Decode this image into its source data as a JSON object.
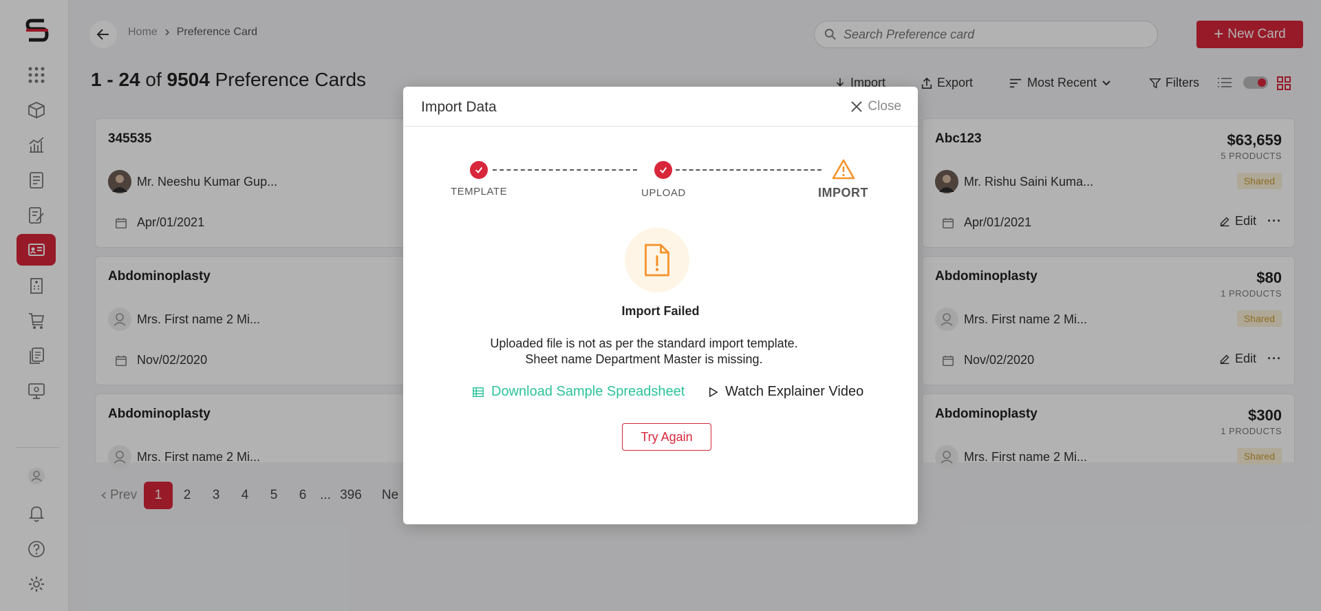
{
  "header": {
    "breadcrumb": [
      "Home",
      "Preference Card"
    ],
    "search_placeholder": "Search Preference card",
    "new_card_label": "New Card"
  },
  "title": {
    "range": "1 - 24",
    "of_word": "of",
    "total": "9504",
    "noun": "Preference Cards"
  },
  "toolbar": {
    "import_label": "Import",
    "export_label": "Export",
    "sort_label": "Most Recent",
    "filters_label": "Filters"
  },
  "cards": [
    {
      "title": "345535",
      "owner": "Mr. Neeshu Kumar Gup...",
      "date": "Apr/01/2021"
    },
    {
      "title": "Abc123",
      "price": "$63,659",
      "products": "5 PRODUCTS",
      "owner": "Mr. Rishu Saini Kuma...",
      "badge": "Shared",
      "date": "Apr/01/2021",
      "edit": "Edit"
    },
    {
      "title": "Abdominoplasty",
      "owner": "Mrs. First name 2 Mi...",
      "date": "Nov/02/2020"
    },
    {
      "title": "Abdominoplasty",
      "price": "$80",
      "products": "1 PRODUCTS",
      "owner": "Mrs. First name 2 Mi...",
      "badge": "Shared",
      "date": "Nov/02/2020",
      "edit": "Edit"
    },
    {
      "title": "Abdominoplasty",
      "owner": "Mrs. First name 2 Mi..."
    },
    {
      "title": "Abdominoplasty",
      "price": "$300",
      "products": "1 PRODUCTS",
      "owner": "Mrs. First name 2 Mi...",
      "badge": "Shared"
    }
  ],
  "pagination": {
    "prev": "Prev",
    "pages": [
      "1",
      "2",
      "3",
      "4",
      "5",
      "6"
    ],
    "ellipsis": "...",
    "last": "396",
    "next": "Ne",
    "current": "1"
  },
  "modal": {
    "title": "Import Data",
    "close_label": "Close",
    "steps": [
      {
        "label": "TEMPLATE",
        "status": "done"
      },
      {
        "label": "UPLOAD",
        "status": "done"
      },
      {
        "label": "IMPORT",
        "status": "warning"
      }
    ],
    "status_title": "Import Failed",
    "message_line1": "Uploaded file is not as per the standard import template.",
    "message_line2": "Sheet name Department Master is missing.",
    "download_label": "Download Sample Spreadsheet",
    "video_label": "Watch Explainer Video",
    "try_again_label": "Try Again"
  },
  "colors": {
    "accent": "#d8263a",
    "link_green": "#2bc29a",
    "warning": "#f5922a"
  }
}
